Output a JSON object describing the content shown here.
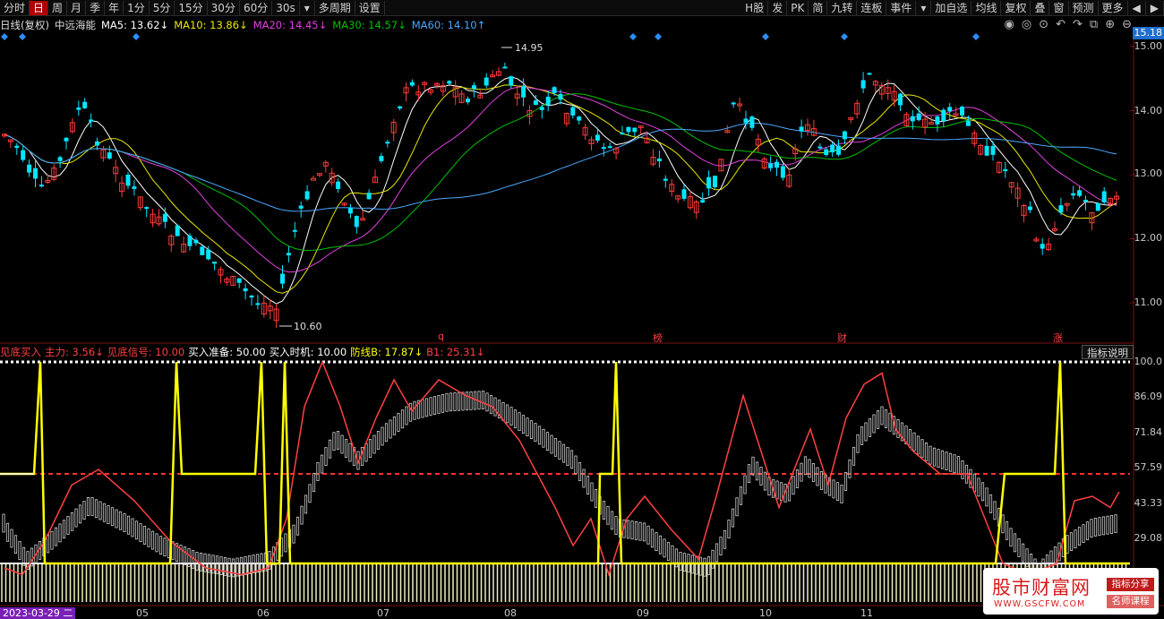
{
  "toolbar": {
    "left_items": [
      "分时",
      "日",
      "周",
      "月",
      "季",
      "年",
      "1分",
      "5分",
      "15分",
      "30分",
      "60分",
      "30s",
      "▾",
      "多周期",
      "设置"
    ],
    "active": "日",
    "right_items": [
      "H股",
      "发",
      "PK",
      "简",
      "九转",
      "连板",
      "事件",
      "▾",
      "加自选",
      "均线",
      "复权",
      "叠",
      "窗",
      "预测",
      "更多",
      "◀",
      "▶"
    ]
  },
  "info": {
    "period": "日线(复权)",
    "stock": "中远海能",
    "ma5": "MA5: 13.62↓",
    "ma10": "MA10: 13.86↓",
    "ma20": "MA20: 14.45↓",
    "ma30": "MA30: 14.57↓",
    "ma60": "MA60: 14.10↑",
    "icons": [
      "eye-icon",
      "circle-icon",
      "play-icon",
      "undo-icon",
      "redo-icon",
      "copy-icon",
      "zoom-in-icon",
      "zoom-out-icon"
    ]
  },
  "price_axis": {
    "current": "15.18",
    "ticks": [
      "15.00",
      "14.00",
      "13.00",
      "12.00",
      "11.00"
    ],
    "high_label": "14.95",
    "low_label": "10.60"
  },
  "event_markers": [
    "q",
    "榜",
    "财",
    "涨"
  ],
  "indicator": {
    "name": "见底买入",
    "main": "主力: 3.56↓",
    "signal": "见底信号: 10.00",
    "prep": "买入准备: 50.00",
    "timing": "买入时机: 10.00",
    "defense": "防线B: 17.87↓",
    "b1": "B1: 25.31↓",
    "help": "指标说明",
    "ticks": [
      "100.0",
      "86.09",
      "71.84",
      "57.59",
      "43.33",
      "29.08"
    ]
  },
  "dates": {
    "start": "2023-03-29 二",
    "months": [
      "05",
      "06",
      "07",
      "08",
      "09",
      "10",
      "11"
    ]
  },
  "watermark": {
    "title": "股市财富网",
    "url": "WWW.GSCFW.COM",
    "tag1": "指标分享",
    "tag2": "名师课程"
  },
  "colors": {
    "up": "#ff3a3a",
    "down": "#00e6ff",
    "ma5": "#ffffff",
    "ma10": "#e8e800",
    "ma20": "#e040e0",
    "ma30": "#00c000",
    "ma60": "#4aa8ff",
    "main_line": "#ff4040",
    "signal": "#ffff00",
    "prep": "#ff3030"
  }
}
